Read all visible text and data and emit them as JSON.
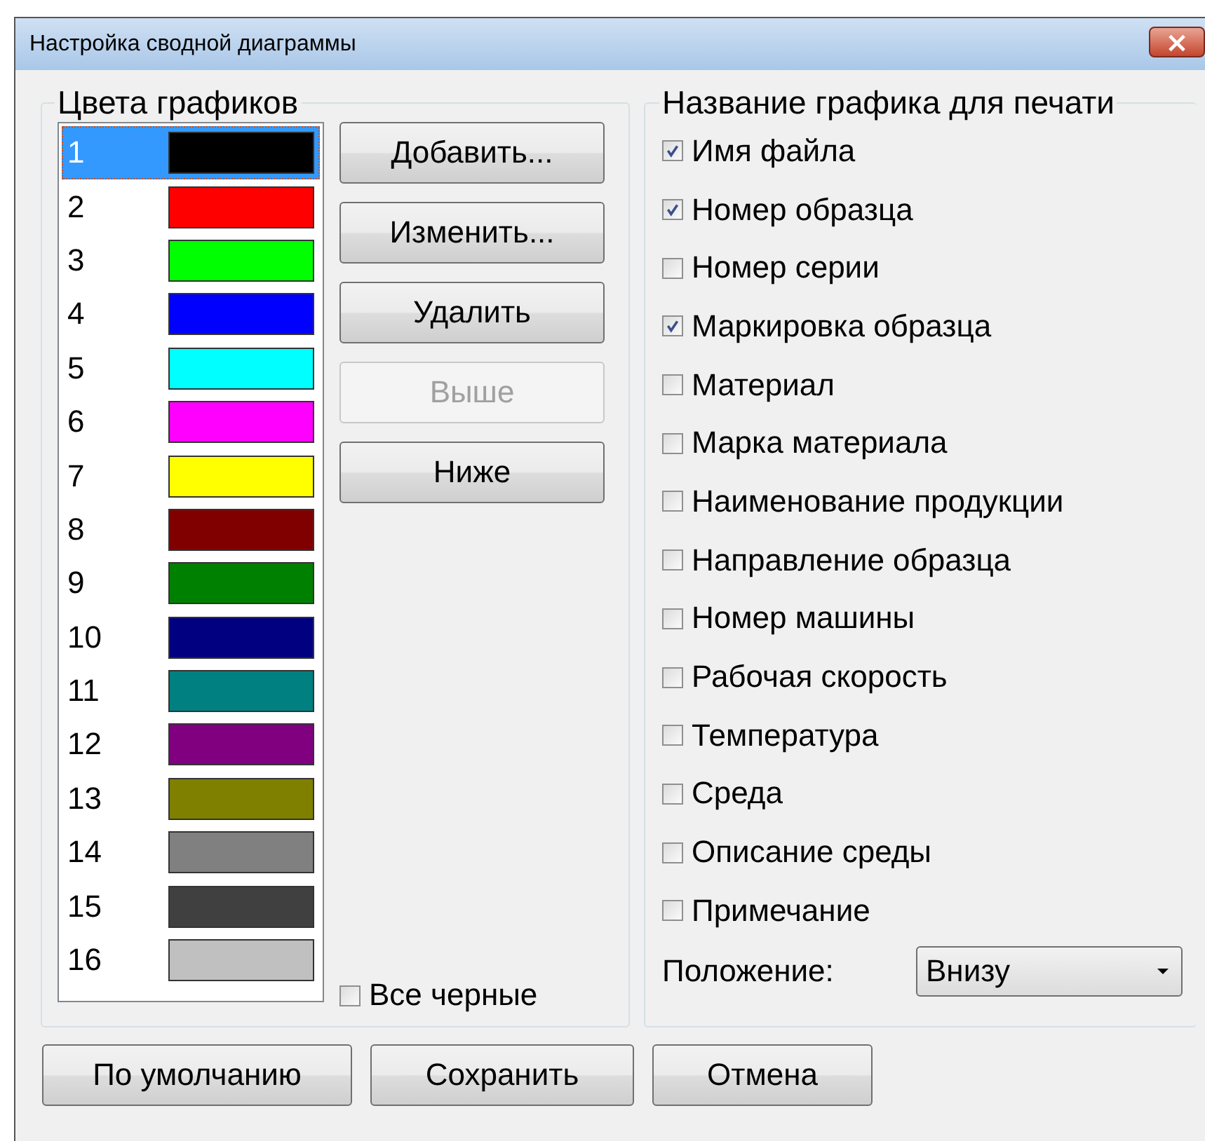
{
  "window": {
    "title": "Настройка сводной диаграммы",
    "close_glyph": "×"
  },
  "colors_group": {
    "title": "Цвета графиков",
    "items": [
      {
        "label": "1",
        "color": "#000000",
        "selected": true
      },
      {
        "label": "2",
        "color": "#ff0000",
        "selected": false
      },
      {
        "label": "3",
        "color": "#00ff00",
        "selected": false
      },
      {
        "label": "4",
        "color": "#0000ff",
        "selected": false
      },
      {
        "label": "5",
        "color": "#00ffff",
        "selected": false
      },
      {
        "label": "6",
        "color": "#ff00ff",
        "selected": false
      },
      {
        "label": "7",
        "color": "#ffff00",
        "selected": false
      },
      {
        "label": "8",
        "color": "#800000",
        "selected": false
      },
      {
        "label": "9",
        "color": "#008000",
        "selected": false
      },
      {
        "label": "10",
        "color": "#000080",
        "selected": false
      },
      {
        "label": "11",
        "color": "#008080",
        "selected": false
      },
      {
        "label": "12",
        "color": "#800080",
        "selected": false
      },
      {
        "label": "13",
        "color": "#808000",
        "selected": false
      },
      {
        "label": "14",
        "color": "#808080",
        "selected": false
      },
      {
        "label": "15",
        "color": "#404040",
        "selected": false
      },
      {
        "label": "16",
        "color": "#c0c0c0",
        "selected": false
      }
    ],
    "buttons": [
      {
        "label": "Добавить...",
        "disabled": false
      },
      {
        "label": "Изменить...",
        "disabled": false
      },
      {
        "label": "Удалить",
        "disabled": false
      },
      {
        "label": "Выше",
        "disabled": true
      },
      {
        "label": "Ниже",
        "disabled": false
      }
    ],
    "all_black": {
      "label": "Все черные",
      "checked": false
    }
  },
  "title_group": {
    "title": "Название графика для печати",
    "options": [
      {
        "label": "Имя файла",
        "checked": true
      },
      {
        "label": "Номер образца",
        "checked": true
      },
      {
        "label": "Номер серии",
        "checked": false
      },
      {
        "label": "Маркировка образца",
        "checked": true
      },
      {
        "label": "Материал",
        "checked": false
      },
      {
        "label": "Марка материала",
        "checked": false
      },
      {
        "label": "Наименование продукции",
        "checked": false
      },
      {
        "label": "Направление образца",
        "checked": false
      },
      {
        "label": "Номер машины",
        "checked": false
      },
      {
        "label": "Рабочая скорость",
        "checked": false
      },
      {
        "label": "Температура",
        "checked": false
      },
      {
        "label": "Среда",
        "checked": false
      },
      {
        "label": "Описание среды",
        "checked": false
      },
      {
        "label": "Примечание",
        "checked": false
      }
    ],
    "position": {
      "label": "Положение:",
      "value": "Внизу"
    }
  },
  "footer_buttons": [
    "По умолчанию",
    "Сохранить",
    "Отмена"
  ]
}
